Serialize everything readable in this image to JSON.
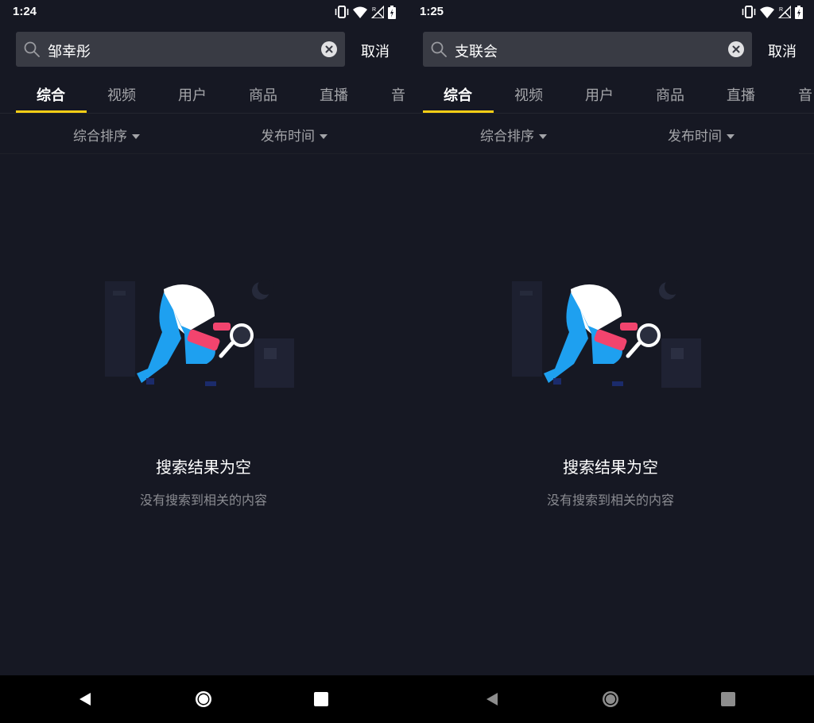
{
  "screens": [
    {
      "status_time": "1:24",
      "search_query": "邹幸彤",
      "cancel_label": "取消",
      "tabs": [
        "综合",
        "视频",
        "用户",
        "商品",
        "直播",
        "音"
      ],
      "filters": [
        "综合排序",
        "发布时间"
      ],
      "empty_title": "搜索结果为空",
      "empty_subtitle": "没有搜索到相关的内容",
      "nav_style": "bright"
    },
    {
      "status_time": "1:25",
      "search_query": "支联会",
      "cancel_label": "取消",
      "tabs": [
        "综合",
        "视频",
        "用户",
        "商品",
        "直播",
        "音"
      ],
      "filters": [
        "综合排序",
        "发布时间"
      ],
      "empty_title": "搜索结果为空",
      "empty_subtitle": "没有搜索到相关的内容",
      "nav_style": "dim"
    }
  ],
  "colors": {
    "background": "#161823",
    "search_box": "#393b44",
    "tab_active_underline": "#face15",
    "tab_inactive": "#a4a5a9",
    "illustration_blue": "#1ea0f0",
    "illustration_pink": "#f2446e"
  },
  "icons": {
    "status": [
      "vibrate-icon",
      "wifi-icon",
      "signal-icon",
      "battery-icon"
    ],
    "search": "search-icon",
    "clear": "clear-icon",
    "nav": [
      "back-icon",
      "home-icon",
      "recents-icon"
    ]
  }
}
